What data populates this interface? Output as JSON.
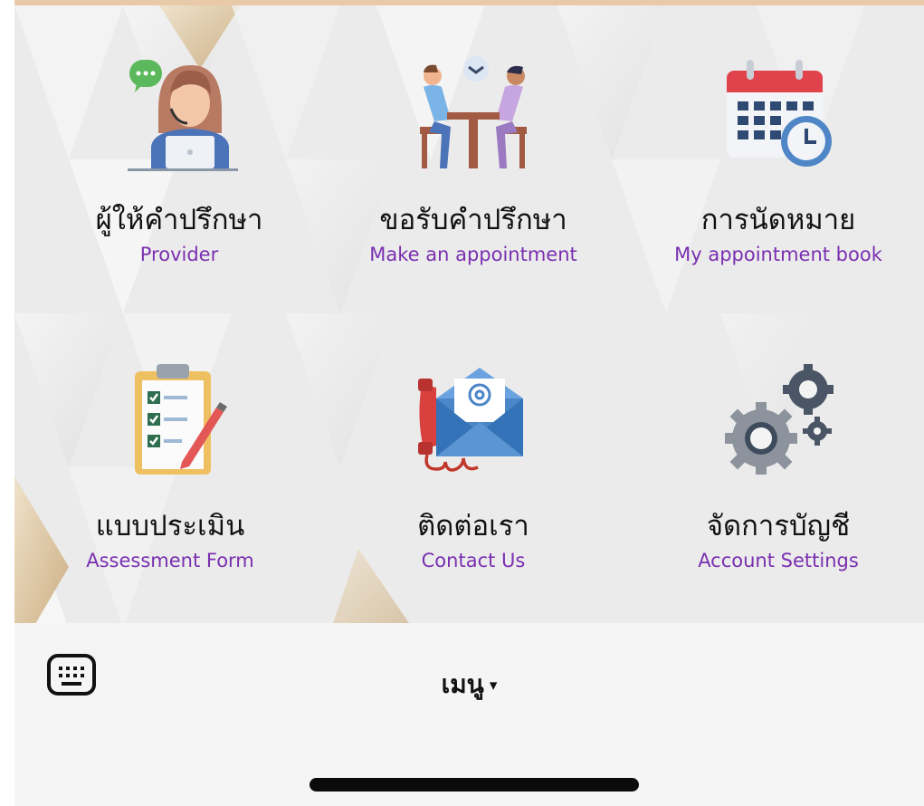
{
  "menu": {
    "items": [
      {
        "thai": "ผู้ให้คำปรึกษา",
        "english": "Provider",
        "icon": "consultant-headset-icon"
      },
      {
        "thai": "ขอรับคำปรึกษา",
        "english": "Make an appointment",
        "icon": "meeting-table-icon"
      },
      {
        "thai": "การนัดหมาย",
        "english": "My appointment book",
        "icon": "calendar-clock-icon"
      },
      {
        "thai": "แบบประเมิน",
        "english": "Assessment Form",
        "icon": "clipboard-checklist-icon"
      },
      {
        "thai": "ติดต่อเรา",
        "english": "Contact Us",
        "icon": "phone-envelope-icon"
      },
      {
        "thai": "จัดการบัญชี",
        "english": "Account Settings",
        "icon": "gears-icon"
      }
    ]
  },
  "bottom_bar": {
    "menu_label": "เมนู",
    "caret": "▾",
    "keyboard_icon": "keyboard-icon"
  },
  "colors": {
    "english_label": "#7a2fb0",
    "top_accent": "#e8c9a8",
    "panel_background": "#ebebeb"
  }
}
